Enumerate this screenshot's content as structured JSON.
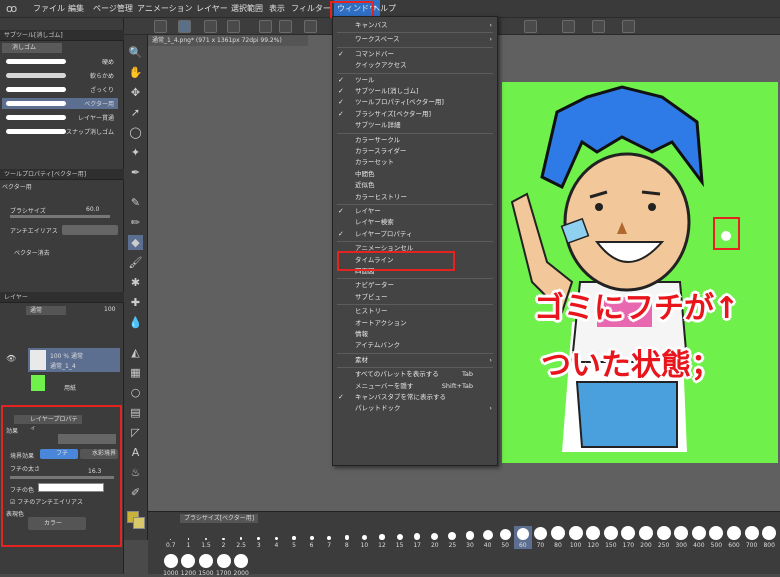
{
  "menubar": {
    "items": [
      "ファイル",
      "編集",
      "ページ管理",
      "アニメーション",
      "レイヤー",
      "選択範囲",
      "表示",
      "フィルター",
      "ウィンドウ",
      "ヘルプ"
    ]
  },
  "document": {
    "tab_title": "通常_1_4.png* (971 x 1361px 72dpi 99.2%)"
  },
  "subtool": {
    "header": "サブツール[消しゴム]",
    "tab": "消しゴム",
    "items": [
      "硬め",
      "軟らかめ",
      "ざっくり",
      "ベクター用",
      "レイヤー貫通",
      "スナップ消しゴム"
    ]
  },
  "toolprop": {
    "header": "ツールプロパティ[ベクター用]",
    "name": "ベクター用",
    "brush_size_label": "ブラシサイズ",
    "brush_size_value": "60.0",
    "aa_label": "アンチエイリアス",
    "vector_label": "ベクター消去"
  },
  "layer": {
    "header": "レイヤー",
    "mode": "通常",
    "opacity": "100",
    "layer1_percent": "100 % 通常",
    "layer1_name": "通常_1_4",
    "layer2_name": "用紙"
  },
  "layerprop": {
    "header": "レイヤープロパティ",
    "effect_label": "効果",
    "border_effect_label": "境界効果",
    "fuchi_label": "フチ",
    "watercolor_label": "水彩境界",
    "thickness_label": "フチの太さ",
    "thickness_value": "16.3",
    "color_label": "フチの色",
    "aa_label": "フチのアンチエイリアス",
    "expr_color_label": "表現色",
    "expr_color_value": "カラー"
  },
  "dropdown": [
    {
      "label": "キャンバス",
      "checked": false,
      "arrow": true
    },
    {
      "sep": true
    },
    {
      "label": "ワークスペース",
      "checked": false,
      "arrow": true
    },
    {
      "sep": true
    },
    {
      "label": "コマンドバー",
      "checked": true
    },
    {
      "label": "クイックアクセス",
      "checked": false
    },
    {
      "sep": true
    },
    {
      "label": "ツール",
      "checked": true
    },
    {
      "label": "サブツール[消しゴム]",
      "checked": true
    },
    {
      "label": "ツールプロパティ[ベクター用]",
      "checked": true
    },
    {
      "label": "ブラシサイズ[ベクター用]",
      "checked": true
    },
    {
      "label": "サブツール詳細",
      "checked": false
    },
    {
      "sep": true
    },
    {
      "label": "カラーサークル",
      "checked": false
    },
    {
      "label": "カラースライダー",
      "checked": false
    },
    {
      "label": "カラーセット",
      "checked": false
    },
    {
      "label": "中間色",
      "checked": false
    },
    {
      "label": "近似色",
      "checked": false
    },
    {
      "label": "カラーヒストリー",
      "checked": false
    },
    {
      "sep": true
    },
    {
      "label": "レイヤー",
      "checked": true
    },
    {
      "label": "レイヤー検索",
      "checked": false
    },
    {
      "label": "レイヤープロパティ",
      "checked": true,
      "highlight": true
    },
    {
      "sep": true
    },
    {
      "label": "アニメーションセル",
      "checked": false
    },
    {
      "label": "タイムライン",
      "checked": false
    },
    {
      "label": "四面図",
      "checked": false
    },
    {
      "sep": true
    },
    {
      "label": "ナビゲーター",
      "checked": false
    },
    {
      "label": "サブビュー",
      "checked": false
    },
    {
      "sep": true
    },
    {
      "label": "ヒストリー",
      "checked": false
    },
    {
      "label": "オートアクション",
      "checked": false
    },
    {
      "label": "情報",
      "checked": false
    },
    {
      "label": "アイテムバンク",
      "checked": false
    },
    {
      "sep": true
    },
    {
      "label": "素材",
      "checked": false,
      "arrow": true
    },
    {
      "sep": true
    },
    {
      "label": "すべてのパレットを表示する",
      "checked": false,
      "shortcut": "Tab"
    },
    {
      "label": "メニューバーを隠す",
      "checked": false,
      "shortcut": "Shift+Tab"
    },
    {
      "label": "キャンバスタブを常に表示する",
      "checked": true
    },
    {
      "label": "パレットドック",
      "checked": false,
      "arrow": true
    }
  ],
  "brushsize": {
    "header": "ブラシサイズ[ベクター用]",
    "row1": [
      "0.7",
      "1",
      "1.5",
      "2",
      "2.5",
      "3",
      "4",
      "5",
      "6",
      "7",
      "8",
      "10",
      "12",
      "15",
      "17",
      "20",
      "25",
      "30",
      "40",
      "50",
      "60",
      "70",
      "80",
      "100",
      "120",
      "150",
      "170",
      "200",
      "250",
      "300",
      "400",
      "500",
      "600",
      "700",
      "800"
    ],
    "row2": [
      "1000",
      "1200",
      "1500",
      "1700",
      "2000"
    ],
    "selected": "60"
  },
  "canvas": {
    "caption1": "ゴミにフチが↑",
    "caption2": "ついた状態；"
  },
  "colors": {
    "highlight": "#e52320",
    "canvas_bg": "#6ff04a"
  }
}
